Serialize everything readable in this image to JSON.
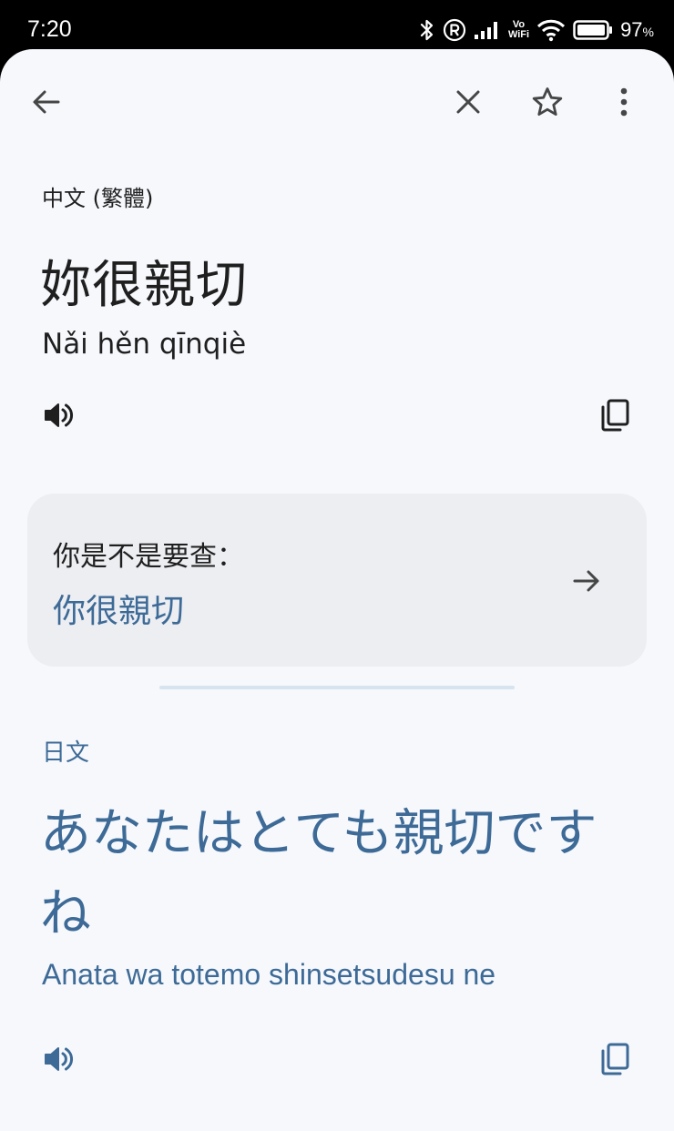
{
  "status_bar": {
    "time": "7:20",
    "vowifi_top": "Vo",
    "vowifi_bottom": "WiFi",
    "battery_percent": "97",
    "battery_unit": "%"
  },
  "toolbar": {
    "back_icon": "arrow-back-icon",
    "close_icon": "close-icon",
    "star_icon": "star-outline-icon",
    "more_icon": "more-vert-icon"
  },
  "source": {
    "language": "中文 (繁體)",
    "text": "妳很親切",
    "romanization": "Nǎi hěn qīnqiè",
    "speak_icon": "volume-icon",
    "copy_icon": "copy-icon"
  },
  "suggestion": {
    "prompt": "你是不是要查：",
    "value": "你很親切",
    "arrow_icon": "arrow-forward-icon"
  },
  "target": {
    "language": "日文",
    "text": "あなたはとても親切ですね",
    "romanization": "Anata wa totemo shinsetsudesu ne",
    "speak_icon": "volume-icon",
    "copy_icon": "copy-icon"
  },
  "colors": {
    "background": "#f6f8fc",
    "card": "#eceef2",
    "accent_text": "#3d6a96",
    "primary_text": "#1f1f1f"
  }
}
